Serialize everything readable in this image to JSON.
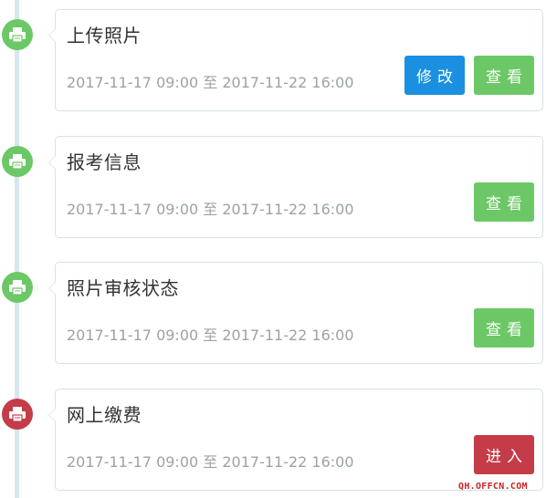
{
  "colors": {
    "node_done": "#6cc866",
    "node_pending": "#c43c48",
    "button_edit": "#1b8fe0",
    "button_view": "#6cc866",
    "button_enter": "#c43c48"
  },
  "steps": [
    {
      "title": "上传照片",
      "time": "2017-11-17 09:00 至 2017-11-22 16:00",
      "icon": "printer-icon",
      "status_color": "green",
      "buttons": [
        {
          "label": "修改",
          "color": "blue"
        },
        {
          "label": "查看",
          "color": "green"
        }
      ]
    },
    {
      "title": "报考信息",
      "time": "2017-11-17 09:00 至 2017-11-22 16:00",
      "icon": "printer-icon",
      "status_color": "green",
      "buttons": [
        {
          "label": "查看",
          "color": "green"
        }
      ]
    },
    {
      "title": "照片审核状态",
      "time": "2017-11-17 09:00 至 2017-11-22 16:00",
      "icon": "printer-icon",
      "status_color": "green",
      "buttons": [
        {
          "label": "查看",
          "color": "green"
        }
      ]
    },
    {
      "title": "网上缴费",
      "time": "2017-11-17 09:00 至 2017-11-22 16:00",
      "icon": "printer-icon",
      "status_color": "red",
      "buttons": [
        {
          "label": "进入",
          "color": "red"
        }
      ]
    }
  ],
  "watermark": "QH.OFFCN.COM"
}
